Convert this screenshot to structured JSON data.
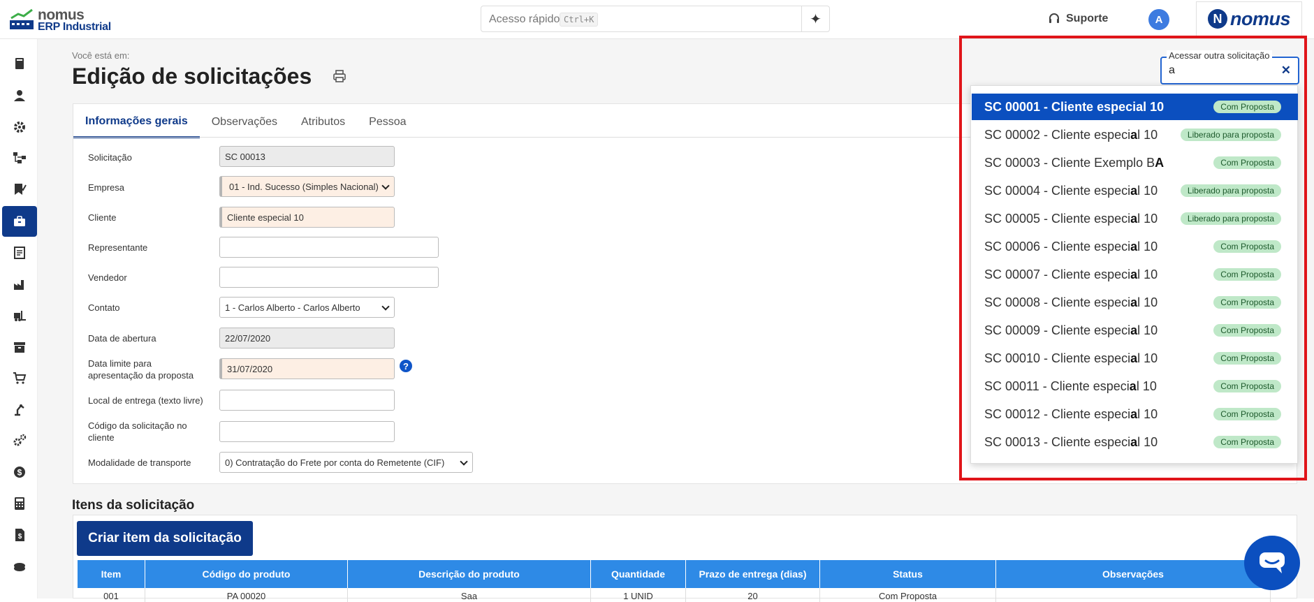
{
  "header": {
    "logo_line1": "nomus",
    "logo_line2": "ERP Industrial",
    "quick_access_placeholder": "Acesso rápido",
    "quick_access_shortcut": "Ctrl+K",
    "support_label": "Suporte",
    "avatar_initial": "A",
    "brand_letter": "N",
    "brand_name": "nomus"
  },
  "page": {
    "breadcrumb_label": "Você está em:",
    "title": "Edição de solicitações"
  },
  "tabs": [
    {
      "label": "Informações gerais",
      "active": true
    },
    {
      "label": "Observações",
      "active": false
    },
    {
      "label": "Atributos",
      "active": false
    },
    {
      "label": "Pessoa",
      "active": false
    }
  ],
  "form": {
    "solicitacao": {
      "label": "Solicitação",
      "value": "SC 00013"
    },
    "empresa": {
      "label": "Empresa",
      "value": "01 - Ind. Sucesso (Simples Nacional)"
    },
    "cliente": {
      "label": "Cliente",
      "value": "Cliente especial 10"
    },
    "representante": {
      "label": "Representante",
      "value": ""
    },
    "vendedor": {
      "label": "Vendedor",
      "value": ""
    },
    "contato": {
      "label": "Contato",
      "value": "1 - Carlos Alberto - Carlos Alberto"
    },
    "data_abertura": {
      "label": "Data de abertura",
      "value": "22/07/2020"
    },
    "data_limite": {
      "label_line1": "Data limite para",
      "label_line2": "apresentação da proposta",
      "value": "31/07/2020"
    },
    "local_entrega": {
      "label": "Local de entrega (texto livre)",
      "value": ""
    },
    "codigo_cliente": {
      "label_line1": "Código da solicitação no",
      "label_line2": "cliente",
      "value": ""
    },
    "modalidade": {
      "label": "Modalidade de transporte",
      "value": "0) Contratação do Frete por conta do Remetente (CIF)"
    }
  },
  "itens": {
    "title": "Itens da solicitação",
    "create_button": "Criar item da solicitação",
    "columns": [
      "Item",
      "Código do produto",
      "Descrição do produto",
      "Quantidade",
      "Prazo de entrega (dias)",
      "Status",
      "Observações"
    ],
    "first_row": [
      "001",
      "PA 00020",
      "Saa",
      "1 UNID",
      "20",
      "Com Proposta",
      ""
    ]
  },
  "other_request": {
    "legend": "Acessar outra solicitação",
    "value": "a",
    "options": [
      {
        "code": "SC 00001 - ",
        "pre": "Cliente especial 10",
        "bold": "",
        "post": "",
        "status": "Com Proposta",
        "selected": true
      },
      {
        "code": "SC 00002 - ",
        "pre": "Cliente especi",
        "bold": "a",
        "post": "l 10",
        "status": "Liberado para proposta",
        "selected": false
      },
      {
        "code": "SC 00003 - ",
        "pre": "Cliente Exemplo B",
        "bold": "A",
        "post": "",
        "status": "Com Proposta",
        "selected": false
      },
      {
        "code": "SC 00004 - ",
        "pre": "Cliente especi",
        "bold": "a",
        "post": "l 10",
        "status": "Liberado para proposta",
        "selected": false
      },
      {
        "code": "SC 00005 - ",
        "pre": "Cliente especi",
        "bold": "a",
        "post": "l 10",
        "status": "Liberado para proposta",
        "selected": false
      },
      {
        "code": "SC 00006 - ",
        "pre": "Cliente especi",
        "bold": "a",
        "post": "l 10",
        "status": "Com Proposta",
        "selected": false
      },
      {
        "code": "SC 00007 - ",
        "pre": "Cliente especi",
        "bold": "a",
        "post": "l 10",
        "status": "Com Proposta",
        "selected": false
      },
      {
        "code": "SC 00008 - ",
        "pre": "Cliente especi",
        "bold": "a",
        "post": "l 10",
        "status": "Com Proposta",
        "selected": false
      },
      {
        "code": "SC 00009 - ",
        "pre": "Cliente especi",
        "bold": "a",
        "post": "l 10",
        "status": "Com Proposta",
        "selected": false
      },
      {
        "code": "SC 00010 - ",
        "pre": "Cliente especi",
        "bold": "a",
        "post": "l 10",
        "status": "Com Proposta",
        "selected": false
      },
      {
        "code": "SC 00011 - ",
        "pre": "Cliente especi",
        "bold": "a",
        "post": "l 10",
        "status": "Com Proposta",
        "selected": false
      },
      {
        "code": "SC 00012 - ",
        "pre": "Cliente especi",
        "bold": "a",
        "post": "l 10",
        "status": "Com Proposta",
        "selected": false
      },
      {
        "code": "SC 00013 - ",
        "pre": "Cliente especi",
        "bold": "a",
        "post": "l 10",
        "status": "Com Proposta",
        "selected": false
      }
    ]
  },
  "sidebar_icons": [
    "book-icon",
    "user-icon",
    "gear-icon",
    "workflow-icon",
    "checklist-icon",
    "briefcase-icon",
    "ledger-icon",
    "factory-icon",
    "forklift-icon",
    "archive-icon",
    "cart-icon",
    "robot-arm-icon",
    "cogs-icon",
    "dollar-icon",
    "calculator-icon",
    "invoice-icon",
    "coins-icon"
  ],
  "colors": {
    "primary": "#0f3a8a",
    "accent": "#0b4fbf",
    "table_header": "#2e8ae6",
    "highlight_border": "#e0151a",
    "badge_bg": "#bfe8c8"
  }
}
